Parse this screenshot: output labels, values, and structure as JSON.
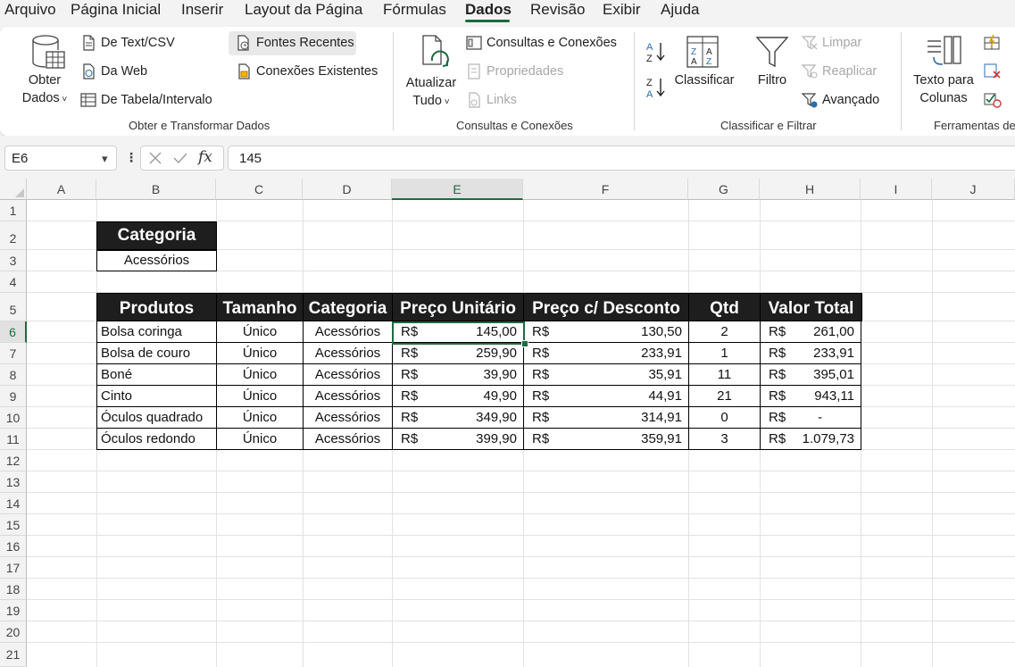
{
  "menu": {
    "items": [
      {
        "label": "Arquivo",
        "name": "menu-arquivo"
      },
      {
        "label": "Página Inicial",
        "name": "menu-pagina-inicial"
      },
      {
        "label": "Inserir",
        "name": "menu-inserir"
      },
      {
        "label": "Layout da Página",
        "name": "menu-layout-da-pagina"
      },
      {
        "label": "Fórmulas",
        "name": "menu-formulas"
      },
      {
        "label": "Dados",
        "name": "menu-dados",
        "active": true
      },
      {
        "label": "Revisão",
        "name": "menu-revisao"
      },
      {
        "label": "Exibir",
        "name": "menu-exibir"
      },
      {
        "label": "Ajuda",
        "name": "menu-ajuda"
      }
    ]
  },
  "ribbon": {
    "obter_dados": {
      "line1": "Obter",
      "line2": "Dados"
    },
    "de_text_csv": "De Text/CSV",
    "da_web": "Da Web",
    "de_tabela": "De Tabela/Intervalo",
    "fontes_recentes": "Fontes Recentes",
    "conexoes_existentes": "Conexões Existentes",
    "group_obter": "Obter e Transformar Dados",
    "atualizar": {
      "line1": "Atualizar",
      "line2": "Tudo"
    },
    "consultas_conexoes": "Consultas e Conexões",
    "propriedades": "Propriedades",
    "links": "Links",
    "group_consultas": "Consultas e Conexões",
    "classificar": "Classificar",
    "filtro": "Filtro",
    "limpar": "Limpar",
    "reaplicar": "Reaplicar",
    "avancado": "Avançado",
    "group_classificar": "Classificar e Filtrar",
    "texto_colunas": {
      "line1": "Texto para",
      "line2": "Colunas"
    },
    "group_ferramentas": "Ferramentas de",
    "accent_color": "#1d6b40"
  },
  "formula_bar": {
    "name_box": "E6",
    "fx_symbol": "fx",
    "value": "145"
  },
  "grid": {
    "columns": [
      "A",
      "B",
      "C",
      "D",
      "E",
      "F",
      "G",
      "H",
      "I",
      "J"
    ],
    "selected_column": "E",
    "rows": [
      "1",
      "2",
      "3",
      "4",
      "5",
      "6",
      "7",
      "8",
      "9",
      "10",
      "11",
      "12",
      "13",
      "14",
      "15",
      "16",
      "17",
      "18",
      "19",
      "20",
      "21"
    ],
    "selected_row": "6"
  },
  "sheet": {
    "filter_header": "Categoria",
    "filter_value": "Acessórios",
    "headers": [
      "Produtos",
      "Tamanho",
      "Categoria",
      "Preço Unitário",
      "Preço c/ Desconto",
      "Qtd",
      "Valor Total"
    ],
    "currency": "R$",
    "rows": [
      {
        "produto": "Bolsa coringa",
        "tamanho": "Único",
        "categoria": "Acessórios",
        "preco": "145,00",
        "desconto": "130,50",
        "qtd": "2",
        "total": "261,00"
      },
      {
        "produto": "Bolsa de couro",
        "tamanho": "Único",
        "categoria": "Acessórios",
        "preco": "259,90",
        "desconto": "233,91",
        "qtd": "1",
        "total": "233,91"
      },
      {
        "produto": "Boné",
        "tamanho": "Único",
        "categoria": "Acessórios",
        "preco": "39,90",
        "desconto": "35,91",
        "qtd": "11",
        "total": "395,01"
      },
      {
        "produto": "Cinto",
        "tamanho": "Único",
        "categoria": "Acessórios",
        "preco": "49,90",
        "desconto": "44,91",
        "qtd": "21",
        "total": "943,11"
      },
      {
        "produto": "Óculos quadrado",
        "tamanho": "Único",
        "categoria": "Acessórios",
        "preco": "349,90",
        "desconto": "314,91",
        "qtd": "0",
        "total": "-"
      },
      {
        "produto": "Óculos redondo",
        "tamanho": "Único",
        "categoria": "Acessórios",
        "preco": "399,90",
        "desconto": "359,91",
        "qtd": "3",
        "total": "1.079,73"
      }
    ]
  }
}
